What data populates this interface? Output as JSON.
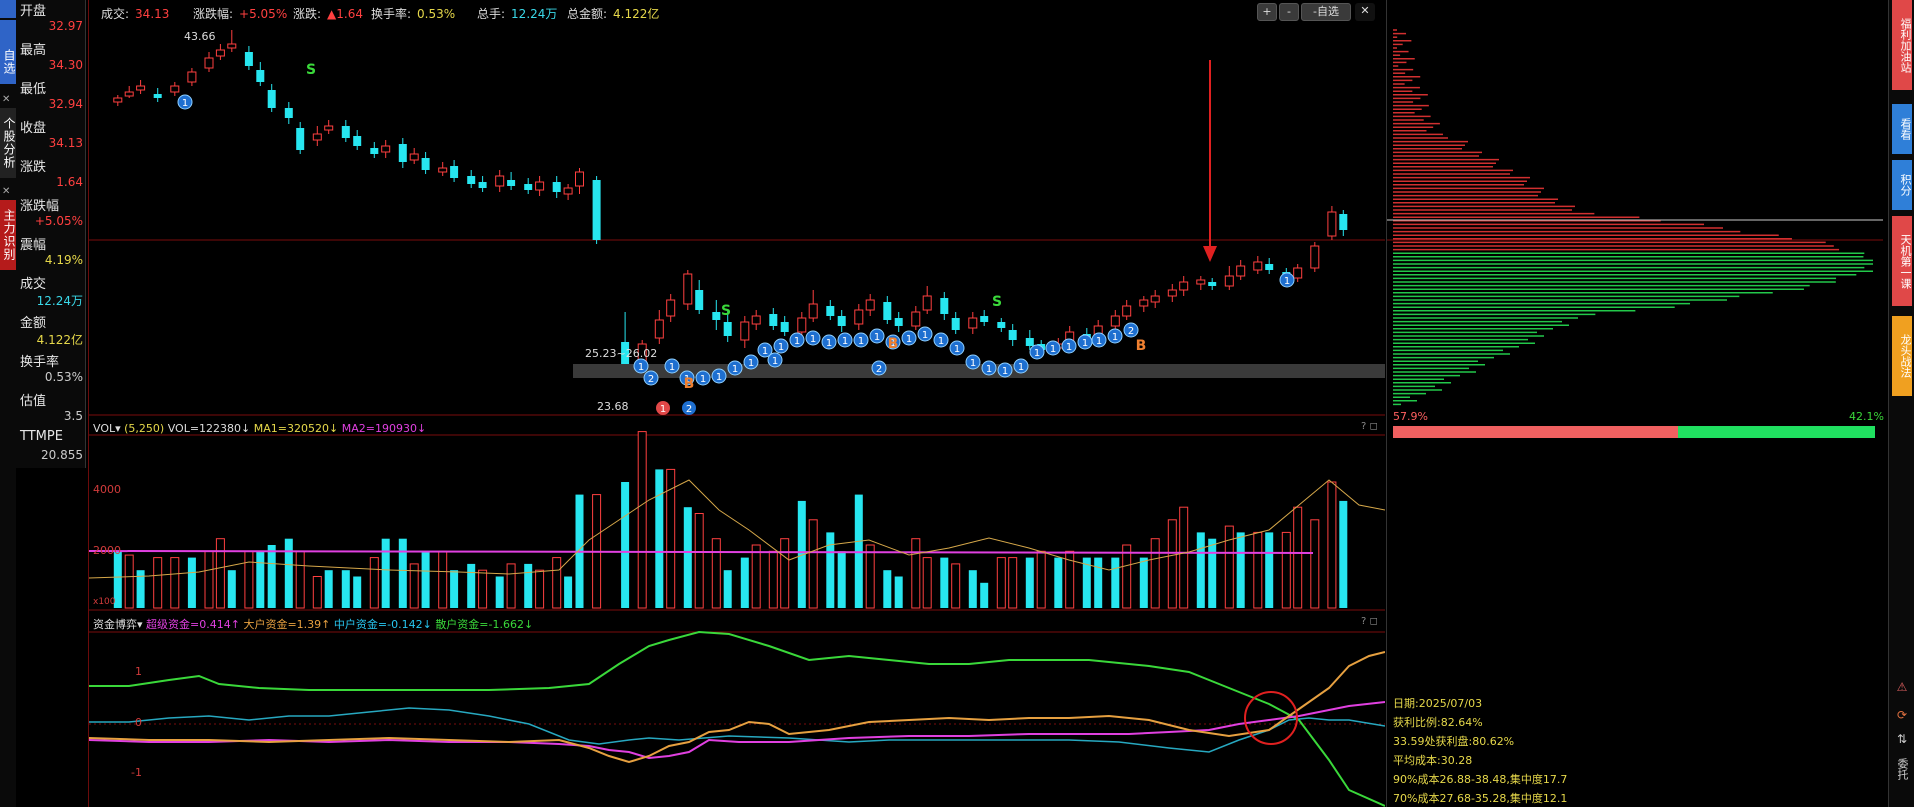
{
  "left_tabs": [
    {
      "label": "自选",
      "color": "blue"
    },
    {
      "label": "个股分析",
      "color": "dark"
    },
    {
      "label": "主力识别",
      "color": "red"
    }
  ],
  "info_panel": [
    {
      "label": "开盘",
      "value": "32.97",
      "color": "#ff4040"
    },
    {
      "label": "最高",
      "value": "34.30",
      "color": "#ff4040"
    },
    {
      "label": "最低",
      "value": "32.94",
      "color": "#ff4040"
    },
    {
      "label": "收盘",
      "value": "34.13",
      "color": "#ff4040"
    },
    {
      "label": "涨跌",
      "value": "1.64",
      "color": "#ff4040"
    },
    {
      "label": "涨跌幅",
      "value": "+5.05%",
      "color": "#ff4040"
    },
    {
      "label": "震幅",
      "value": "4.19%",
      "color": "#e6d84a"
    },
    {
      "label": "成交",
      "value": "12.24万",
      "color": "#3ad8e8"
    },
    {
      "label": "金额",
      "value": "4.122亿",
      "color": "#e6d84a"
    },
    {
      "label": "换手率",
      "value": "0.53%",
      "color": "#cccccc"
    },
    {
      "label": "估值",
      "value": "3.5",
      "color": "#cccccc"
    },
    {
      "label": "TTMPE",
      "value": "20.855",
      "color": "#cccccc"
    }
  ],
  "topbar": [
    {
      "label": "成交:",
      "value": "34.13",
      "color": "#ff4040"
    },
    {
      "label": "涨跌幅:",
      "value": "+5.05%",
      "color": "#ff4040"
    },
    {
      "label": "涨跌:",
      "value": "▲1.64",
      "color": "#ff4040"
    },
    {
      "label": "换手率:",
      "value": "0.53%",
      "color": "#e6d84a"
    },
    {
      "label": "总手:",
      "value": "12.24万",
      "color": "#3ad8e8"
    },
    {
      "label": "总金额:",
      "value": "4.122亿",
      "color": "#e6d84a"
    }
  ],
  "toolbar": {
    "zoom_in": "+",
    "zoom_out": "-",
    "watchlist": "-自选",
    "close": "✕"
  },
  "price_annotations": {
    "high": "43.66",
    "range_text": "25.23~26.02",
    "low": "23.68",
    "signal_s": "S",
    "signal_b": "B"
  },
  "vol_panel": {
    "title": "VOL▾",
    "params": "(5,250)",
    "vol": "VOL=122380↓",
    "ma1": "MA1=320520↓",
    "ma2": "MA2=190930↓",
    "y_labels": [
      "4000",
      "2000"
    ],
    "unit": "x100"
  },
  "fund_panel": {
    "title": "资金博弈▾",
    "super": "超级资金=0.414↑",
    "large": "大户资金=1.39↑",
    "medium": "中户资金=-0.142↓",
    "retail": "散户资金=-1.662↓",
    "y_labels": [
      "1",
      "0",
      "-1"
    ]
  },
  "chip": {
    "left_pct": "57.9%",
    "right_pct": "42.1%",
    "date": "日期:2025/07/03",
    "profit_ratio": "获利比例:82.64%",
    "profit_at": "33.59处获利盘:80.62%",
    "avg_cost": "平均成本:30.28",
    "cost90": "90%成本26.88-38.48,集中度17.7",
    "cost70": "70%成本27.68-35.28,集中度12.1"
  },
  "right_tabs": [
    {
      "label": "福利加油站",
      "color": "#e04848"
    },
    {
      "label": "看看",
      "color": "#2f7fd8"
    },
    {
      "label": "积分",
      "color": "#2f7fd8"
    },
    {
      "label": "天机第一课",
      "color": "#e04848"
    },
    {
      "label": "龙头战法",
      "color": "#f0a020"
    }
  ],
  "right_icons": [
    "⚠",
    "⟳",
    "⇅",
    "委托"
  ],
  "colors": {
    "up": "#ff4040",
    "down": "#27e6f0",
    "grid": "#7a0b0b",
    "ma": "#d6a84a",
    "ma2": "#e040e0",
    "green": "#3ad83a"
  }
}
